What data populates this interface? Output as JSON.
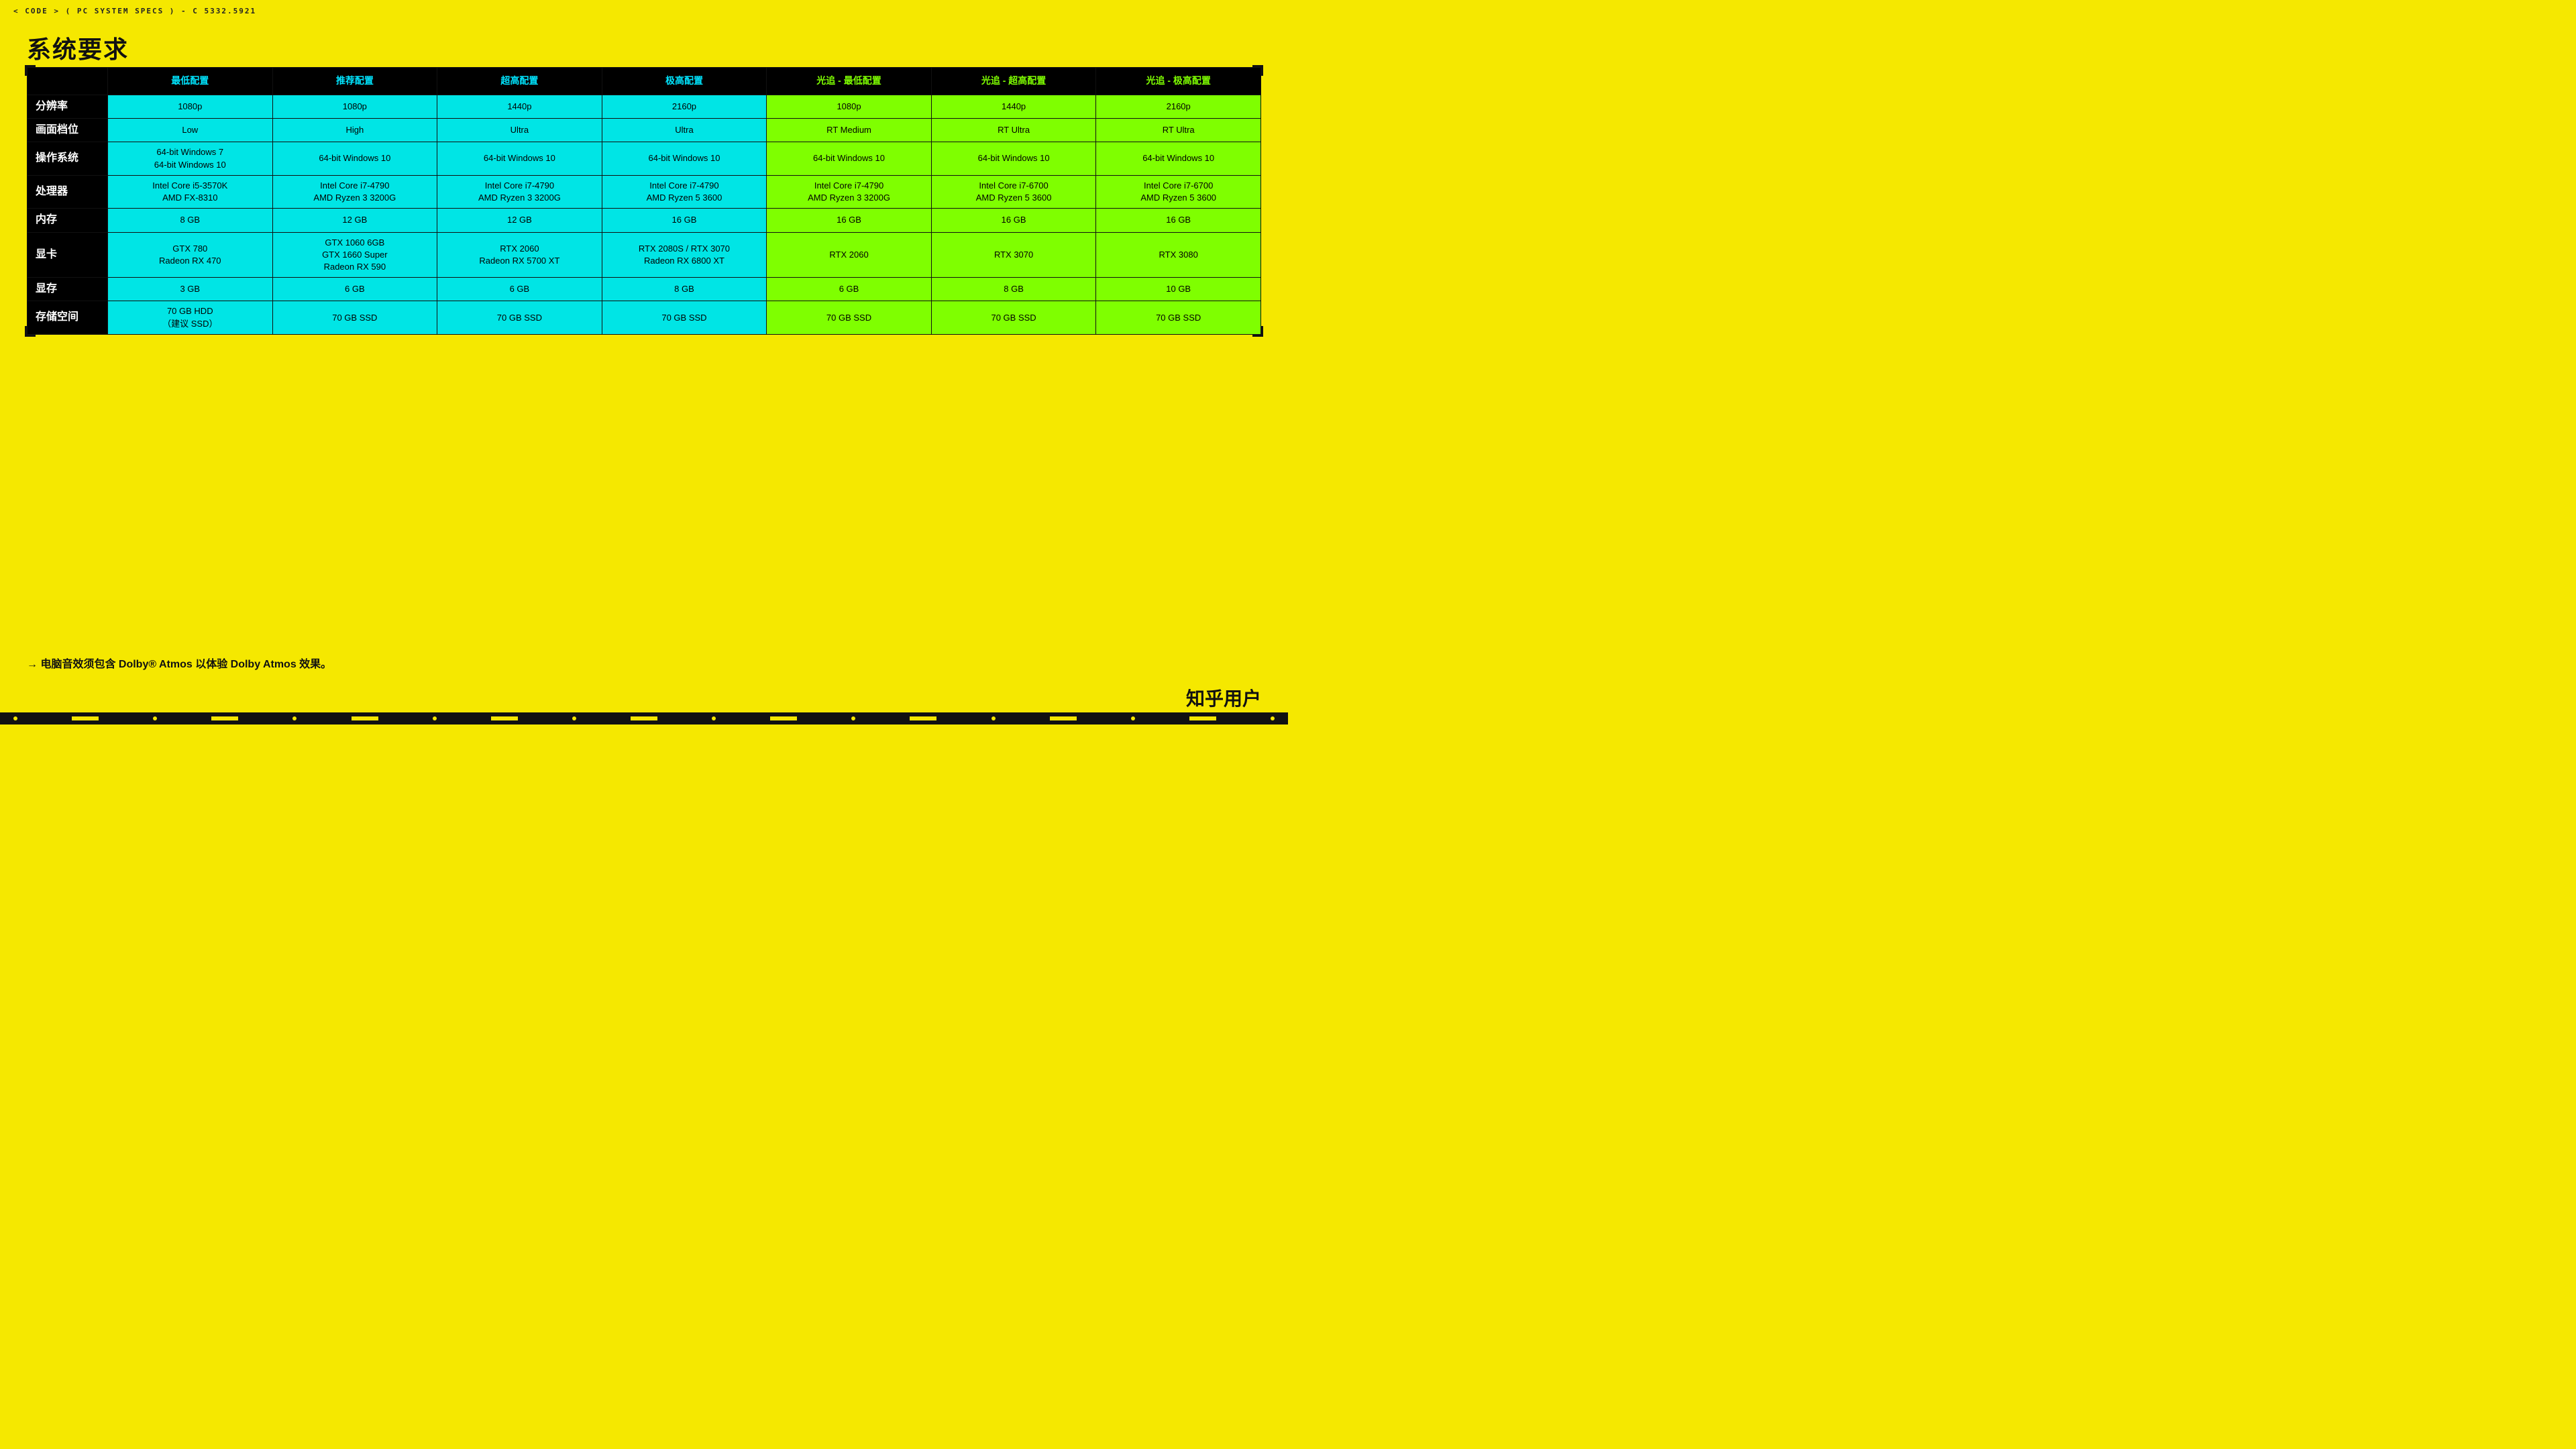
{
  "topbar": {
    "text": "< CODE > ( PC SYSTEM SPECS ) - C 5332.5921"
  },
  "page_title": "系统要求",
  "footer_note": "→ 电脑音效须包含 Dolby® Atmos 以体验 Dolby Atmos 效果。",
  "watermark": "知乎用户",
  "table": {
    "headers": [
      "",
      "最低配置",
      "推荐配置",
      "超高配置",
      "极高配置",
      "光追 - 最低配置",
      "光追 - 超高配置",
      "光追 - 极高配置"
    ],
    "rows": [
      {
        "label": "分辨率",
        "values": [
          "1080p",
          "1080p",
          "1440p",
          "2160p",
          "1080p",
          "1440p",
          "2160p"
        ]
      },
      {
        "label": "画面档位",
        "values": [
          "Low",
          "High",
          "Ultra",
          "Ultra",
          "RT Medium",
          "RT Ultra",
          "RT Ultra"
        ]
      },
      {
        "label": "操作系统",
        "values": [
          "64-bit Windows 7\n64-bit Windows 10",
          "64-bit Windows 10",
          "64-bit Windows 10",
          "64-bit Windows 10",
          "64-bit Windows 10",
          "64-bit Windows 10",
          "64-bit Windows 10"
        ]
      },
      {
        "label": "处理器",
        "values": [
          "Intel Core i5-3570K\nAMD FX-8310",
          "Intel Core i7-4790\nAMD Ryzen 3 3200G",
          "Intel Core i7-4790\nAMD Ryzen 3 3200G",
          "Intel Core i7-4790\nAMD Ryzen 5 3600",
          "Intel Core i7-4790\nAMD Ryzen 3 3200G",
          "Intel Core i7-6700\nAMD Ryzen 5 3600",
          "Intel Core i7-6700\nAMD Ryzen 5 3600"
        ]
      },
      {
        "label": "内存",
        "values": [
          "8 GB",
          "12 GB",
          "12 GB",
          "16 GB",
          "16 GB",
          "16 GB",
          "16 GB"
        ]
      },
      {
        "label": "显卡",
        "values": [
          "GTX 780\nRadeon RX 470",
          "GTX 1060 6GB\nGTX 1660 Super\nRadeon RX 590",
          "RTX 2060\nRadeon RX 5700 XT",
          "RTX 2080S / RTX 3070\nRadeon RX 6800 XT",
          "RTX 2060",
          "RTX 3070",
          "RTX 3080"
        ]
      },
      {
        "label": "显存",
        "values": [
          "3 GB",
          "6 GB",
          "6 GB",
          "8 GB",
          "6 GB",
          "8 GB",
          "10 GB"
        ]
      },
      {
        "label": "存储空间",
        "values": [
          "70 GB HDD\n（建议 SSD）",
          "70 GB SSD",
          "70 GB SSD",
          "70 GB SSD",
          "70 GB SSD",
          "70 GB SSD",
          "70 GB SSD"
        ]
      }
    ]
  }
}
